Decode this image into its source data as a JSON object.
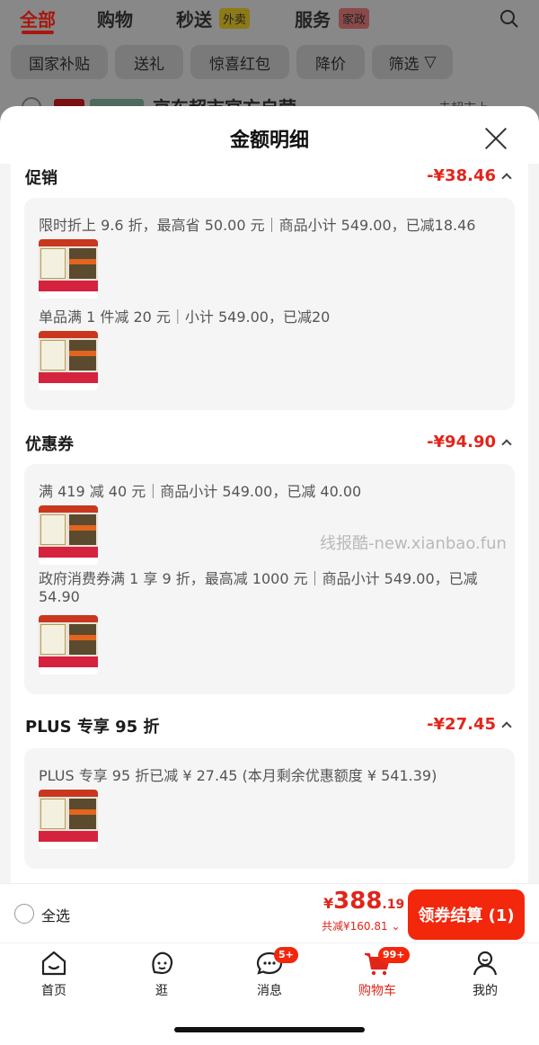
{
  "background": {
    "tabs": [
      {
        "label": "全部",
        "active": true
      },
      {
        "label": "购物"
      },
      {
        "label": "秒送",
        "tag": "外卖"
      },
      {
        "label": "服务",
        "tag": "家政"
      }
    ],
    "chips": [
      "国家补贴",
      "送礼",
      "惊喜红包",
      "降价",
      "筛选"
    ],
    "store_name": "京东超市官方自营",
    "store_right": "去超市上"
  },
  "sheet": {
    "title": "金额明细",
    "sections": [
      {
        "title": "促销",
        "amount": "-¥38.46",
        "items": [
          {
            "text": "限时折上 9.6 折，最高省 50.00 元｜商品小计 549.00，已减18.46"
          },
          {
            "text": "单品满 1 件减 20 元｜小计 549.00，已减20"
          }
        ]
      },
      {
        "title": "优惠券",
        "amount": "-¥94.90",
        "items": [
          {
            "text": "满 419 减 40 元｜商品小计 549.00，已减 40.00"
          },
          {
            "text": "政府消费券满 1 享 9 折，最高减 1000 元｜商品小计 549.00，已减 54.90"
          }
        ]
      },
      {
        "title": "PLUS 专享 95 折",
        "amount": "-¥27.45",
        "items": [
          {
            "text": "PLUS 专享 95 折已减 ¥ 27.45 (本月剩余优惠额度 ¥ 541.39)"
          }
        ]
      }
    ],
    "watermark": "线报酷-new.xianbao.fun"
  },
  "checkout": {
    "select_all": "全选",
    "currency": "¥",
    "price_int": "388",
    "price_dec": ".19",
    "total_saved": "共减¥160.81",
    "button": "领券结算 (1)"
  },
  "nav": {
    "items": [
      {
        "label": "首页",
        "icon": "home-icon"
      },
      {
        "label": "逛",
        "icon": "explore-icon"
      },
      {
        "label": "消息",
        "icon": "message-icon",
        "badge": "5+"
      },
      {
        "label": "购物车",
        "icon": "cart-icon",
        "badge": "99+",
        "active": true
      },
      {
        "label": "我的",
        "icon": "profile-icon"
      }
    ]
  },
  "colors": {
    "accent": "#e1251b",
    "button": "#f2270c"
  }
}
